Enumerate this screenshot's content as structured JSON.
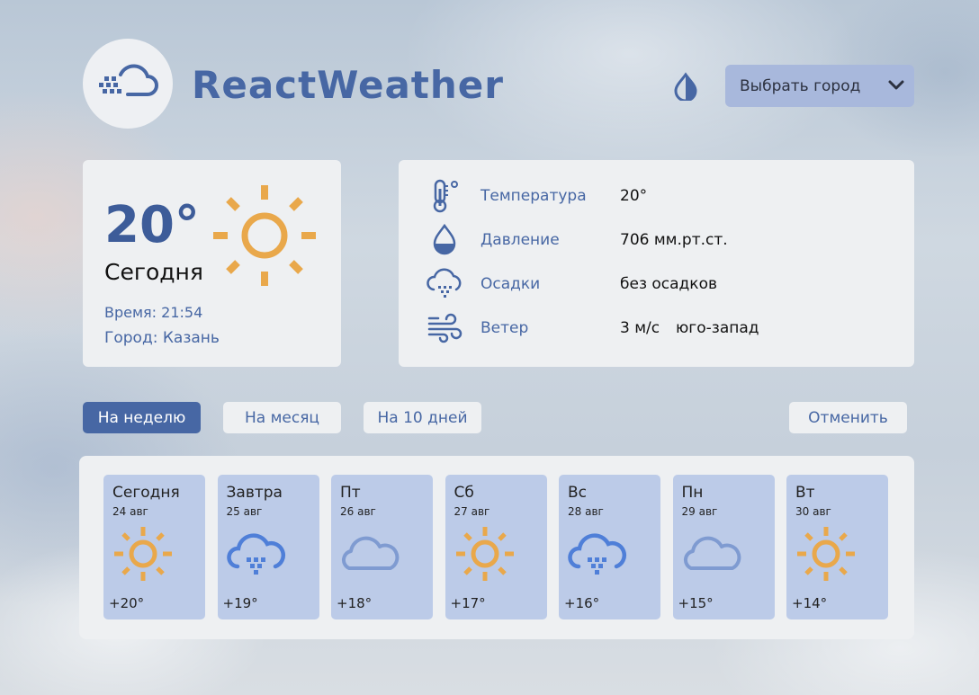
{
  "header": {
    "brand": "ReactWeather",
    "logo_icon": "cloud-wind-icon",
    "theme_icon": "half-drop-icon",
    "city_select": {
      "label": "Выбрать город",
      "icon": "chevron-down-icon"
    }
  },
  "today": {
    "temperature": "20°",
    "label": "Сегодня",
    "time": "Время: 21:54",
    "city": "Город: Казань",
    "icon": "sun-icon"
  },
  "details": [
    {
      "icon": "thermometer-icon",
      "name": "Температура",
      "value": "20°",
      "extra": ""
    },
    {
      "icon": "drop-icon",
      "name": "Давление",
      "value": "706 мм.рт.ст.",
      "extra": ""
    },
    {
      "icon": "rain-cloud-icon",
      "name": "Осадки",
      "value": "без осадков",
      "extra": ""
    },
    {
      "icon": "wind-icon",
      "name": "Ветер",
      "value": "3 м/с",
      "extra": "юго-запад"
    }
  ],
  "tabs": {
    "week": "На неделю",
    "month": "На месяц",
    "ten_days": "На 10 дней",
    "cancel": "Отменить"
  },
  "forecast": [
    {
      "day": "Сегодня",
      "date": "24 авг",
      "icon": "sun-icon",
      "temp": "+20°"
    },
    {
      "day": "Завтра",
      "date": "25 авг",
      "icon": "rain-cloud-icon",
      "temp": "+19°"
    },
    {
      "day": "Пт",
      "date": "26 авг",
      "icon": "cloud-icon",
      "temp": "+18°"
    },
    {
      "day": "Сб",
      "date": "27 авг",
      "icon": "sun-icon",
      "temp": "+17°"
    },
    {
      "day": "Вс",
      "date": "28 авг",
      "icon": "rain-cloud-icon",
      "temp": "+16°"
    },
    {
      "day": "Пн",
      "date": "29 авг",
      "icon": "cloud-icon",
      "temp": "+15°"
    },
    {
      "day": "Вт",
      "date": "30 авг",
      "icon": "sun-icon",
      "temp": "+14°"
    }
  ],
  "colors": {
    "accent": "#4767a4",
    "sun": "#e9a84b",
    "cloud": "#7f9bd1",
    "card": "#eef0f2",
    "day_card": "#bccbe8",
    "select": "#a8b8dc"
  }
}
